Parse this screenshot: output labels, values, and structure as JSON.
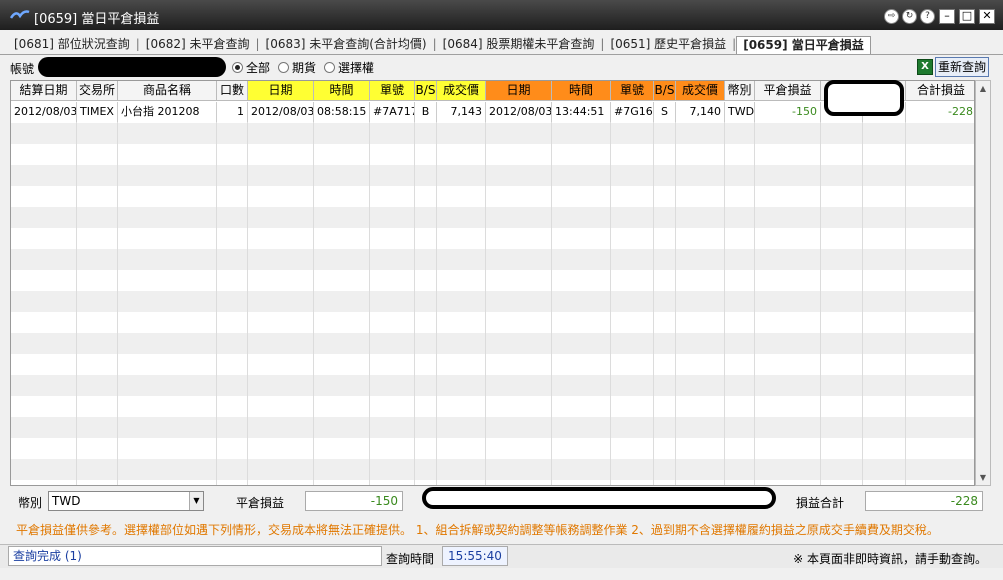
{
  "window": {
    "title": "[0659] 當日平倉損益",
    "controls": [
      "exit-icon",
      "refresh-circle-icon",
      "help-icon",
      "minimize",
      "maximize",
      "close"
    ]
  },
  "tabs": [
    {
      "label": "[0681] 部位狀況查詢",
      "active": false
    },
    {
      "label": "[0682] 未平倉查詢",
      "active": false
    },
    {
      "label": "[0683] 未平倉查詢(合計均價)",
      "active": false
    },
    {
      "label": "[0684] 股票期權未平倉查詢",
      "active": false
    },
    {
      "label": "[0651] 歷史平倉損益",
      "active": false
    },
    {
      "label": "[0659] 當日平倉損益",
      "active": true
    }
  ],
  "filter": {
    "account_label": "帳號",
    "options": [
      {
        "label": "全部",
        "checked": true
      },
      {
        "label": "期貨",
        "checked": false
      },
      {
        "label": "選擇權",
        "checked": false
      }
    ],
    "excel_icon": "X",
    "refresh_label": "重新查詢"
  },
  "table": {
    "headers": [
      "結算日期",
      "交易所",
      "商品名稱",
      "口數",
      "日期",
      "時間",
      "單號",
      "B/S",
      "成交價",
      "日期",
      "時間",
      "單號",
      "B/S",
      "成交價",
      "幣別",
      "平倉損益",
      "",
      "",
      "合計損益"
    ],
    "rows": [
      [
        "2012/08/03",
        "TIMEX",
        "小台指 201208",
        "1",
        "2012/08/03",
        "08:58:15",
        "#7A717",
        "B",
        "7,143",
        "2012/08/03",
        "13:44:51",
        "#7G166",
        "S",
        "7,140",
        "TWD",
        "-150",
        "",
        "",
        "-228"
      ]
    ],
    "colors": {
      "open_header": "#ffff33",
      "close_header": "#ff8c1a",
      "profit_text": "#3a8a1e"
    }
  },
  "summary": {
    "currency_label": "幣別",
    "currency_value": "TWD",
    "pnl_label": "平倉損益",
    "pnl_value": "-150",
    "total_label": "損益合計",
    "total_value": "-228"
  },
  "notice": "平倉損益僅供參考。選擇權部位如遇下列情形，交易成本將無法正確提供。  1、組合拆解或契約調整等帳務調整作業  2、過到期不含選擇權履約損益之原成交手續費及期交稅。",
  "status": {
    "message": "查詢完成 (1)",
    "query_time_label": "查詢時間",
    "query_time": "15:55:40",
    "note": "※ 本頁面非即時資訊，請手動查詢。"
  }
}
